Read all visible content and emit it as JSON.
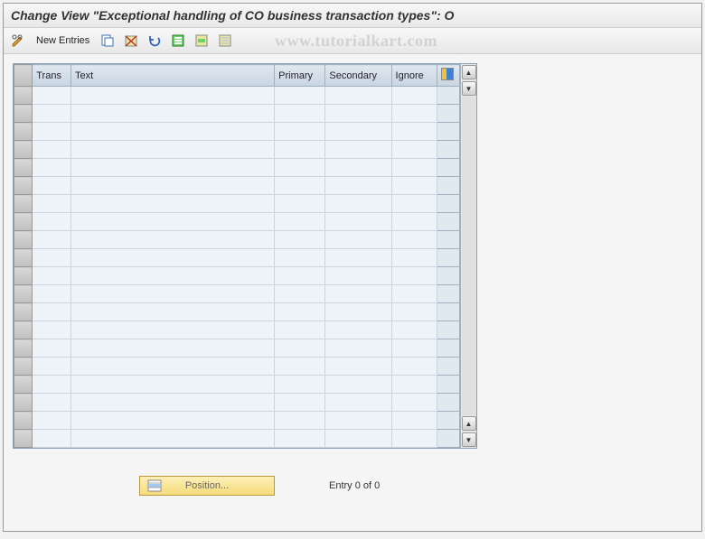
{
  "title": "Change View \"Exceptional handling of CO business transaction types\": O",
  "toolbar": {
    "new_entries_label": "New Entries"
  },
  "watermark": "www.tutorialkart.com",
  "table": {
    "columns": {
      "trans": "Trans",
      "text": "Text",
      "primary": "Primary",
      "secondary": "Secondary",
      "ignore": "Ignore"
    },
    "row_count": 20
  },
  "footer": {
    "position_label": "Position...",
    "entry_status": "Entry 0 of 0"
  },
  "icons": {
    "toggle": "toggle-icon",
    "copy": "copy-icon",
    "delete": "delete-icon",
    "undo": "undo-icon",
    "select_all": "select-all-icon",
    "select_block": "select-block-icon",
    "deselect_all": "deselect-all-icon",
    "settings": "table-settings-icon",
    "position": "position-icon"
  }
}
